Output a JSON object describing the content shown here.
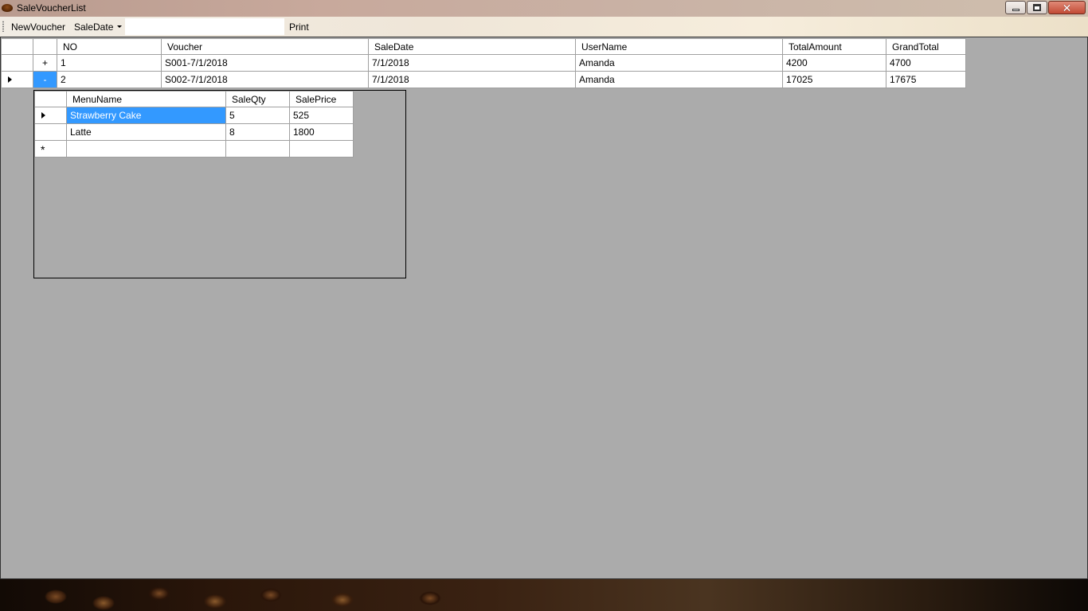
{
  "window": {
    "title": "SaleVoucherList",
    "icon": "coffee-cake-icon"
  },
  "toolbar": {
    "new_voucher": "NewVoucher",
    "sale_date": "SaleDate",
    "date_value": "",
    "print": "Print"
  },
  "master": {
    "columns": [
      "NO",
      "Voucher",
      "SaleDate",
      "UserName",
      "TotalAmount",
      "GrandTotal"
    ],
    "rows": [
      {
        "expander": "+",
        "no": "1",
        "voucher": "S001-7/1/2018",
        "sale_date": "7/1/2018",
        "user": "Amanda",
        "total": "4200",
        "grand_total": "4700"
      },
      {
        "expander": "-",
        "no": "2",
        "voucher": "S002-7/1/2018",
        "sale_date": "7/1/2018",
        "user": "Amanda",
        "total": "17025",
        "grand_total": "17675"
      }
    ]
  },
  "detail": {
    "columns": [
      "MenuName",
      "SaleQty",
      "SalePrice"
    ],
    "rows": [
      {
        "menu": "Strawberry Cake",
        "qty": "5",
        "price": "525"
      },
      {
        "menu": "Latte",
        "qty": "8",
        "price": "1800"
      }
    ],
    "new_row_symbol": "*"
  },
  "colors": {
    "selection": "#3399ff",
    "grid_background": "#ababab"
  }
}
